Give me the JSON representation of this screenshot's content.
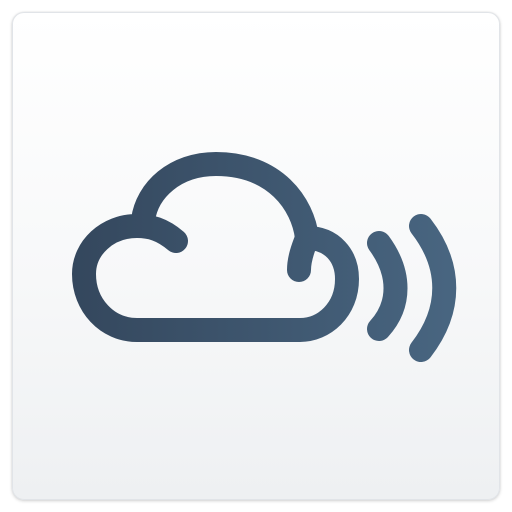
{
  "icon": {
    "name": "cloud-with-sound-waves-icon",
    "colors": {
      "tile_top": "#ffffff",
      "tile_bottom": "#eef0f2",
      "tile_border": "#e1e4e8",
      "stroke_start": "#34475d",
      "stroke_end": "#486580"
    }
  }
}
